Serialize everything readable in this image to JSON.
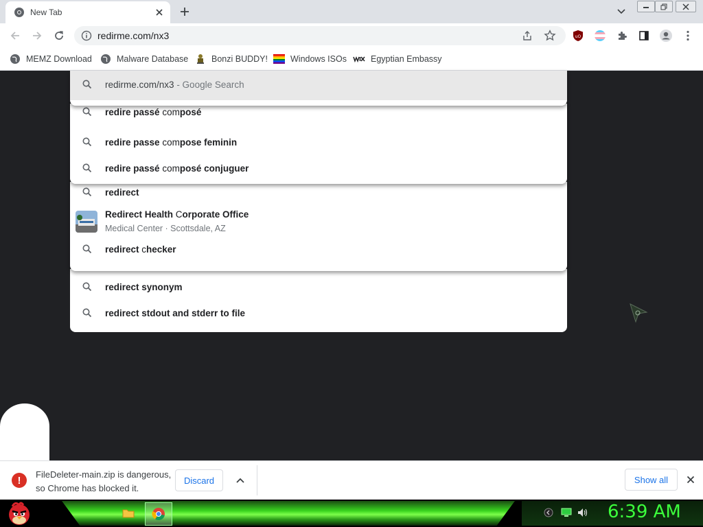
{
  "tab": {
    "title": "New Tab"
  },
  "omnibox": {
    "value": "redirme.com/nx3"
  },
  "bookmarks": [
    {
      "label": "MEMZ Download"
    },
    {
      "label": "Malware Database"
    },
    {
      "label": "Bonzi BUDDY!"
    },
    {
      "label": "Windows ISOs"
    },
    {
      "label": "Egyptian Embassy"
    }
  ],
  "suggestions": {
    "top": {
      "query": "redirme.com/nx3",
      "suffix": "- Google Search"
    },
    "s1": {
      "a": "redire passé ",
      "b": "com",
      "c": "posé"
    },
    "s2": {
      "a": "redire passe ",
      "b": "com",
      "c": "pose feminin"
    },
    "s3": {
      "a": "redire passé ",
      "b": "com",
      "c": "posé conjuguer"
    },
    "s4": {
      "a": "redirect"
    },
    "s5": {
      "a": "Redirect Health ",
      "b": "C",
      "c": "orporate Office",
      "sub": "Medical Center · Scottsdale, AZ"
    },
    "s6": {
      "a": "redirect ",
      "b": "c",
      "c": "hecker"
    },
    "s7": {
      "a": "redirect synonym"
    },
    "s8": {
      "a": "redirect stdout and stderr to file"
    }
  },
  "download": {
    "message_line1": "FileDeleter-main.zip is dangerous,",
    "message_line2": "so Chrome has blocked it.",
    "discard_label": "Discard",
    "show_all_label": "Show all"
  },
  "taskbar": {
    "clock": "6:39 AM"
  },
  "colors": {
    "accent": "#1a73e8",
    "danger": "#d93025",
    "clock": "#3cff3c",
    "content_bg": "#202124"
  }
}
